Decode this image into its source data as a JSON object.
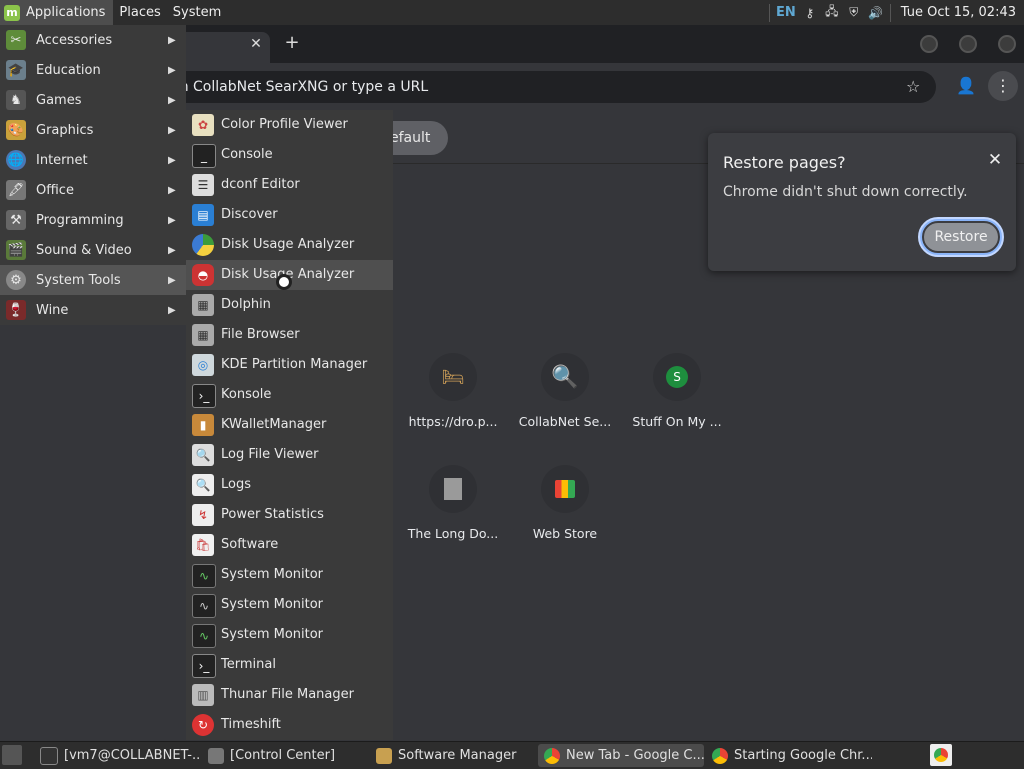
{
  "top_panel": {
    "applications_label": "Applications",
    "places_label": "Places",
    "system_label": "System",
    "lang": "EN",
    "clock": "Tue Oct 15, 02:43",
    "tray_icons": [
      "key-icon",
      "network-icon",
      "shield-icon",
      "volume-icon"
    ]
  },
  "menu": {
    "categories": [
      {
        "label": "Accessories",
        "icon": "accessories-icon"
      },
      {
        "label": "Education",
        "icon": "education-icon"
      },
      {
        "label": "Games",
        "icon": "games-icon"
      },
      {
        "label": "Graphics",
        "icon": "graphics-icon"
      },
      {
        "label": "Internet",
        "icon": "internet-icon"
      },
      {
        "label": "Office",
        "icon": "office-icon"
      },
      {
        "label": "Programming",
        "icon": "programming-icon"
      },
      {
        "label": "Sound & Video",
        "icon": "sound-video-icon"
      },
      {
        "label": "System Tools",
        "icon": "system-tools-icon"
      },
      {
        "label": "Wine",
        "icon": "wine-icon"
      }
    ],
    "items": [
      {
        "label": "Color Profile Viewer",
        "icon": "color-profile-icon"
      },
      {
        "label": "Console",
        "icon": "console-icon"
      },
      {
        "label": "dconf Editor",
        "icon": "dconf-icon"
      },
      {
        "label": "Discover",
        "icon": "discover-icon"
      },
      {
        "label": "Disk Usage Analyzer",
        "icon": "disk-usage-icon"
      },
      {
        "label": "Disk Usage Analyzer",
        "icon": "disk-usage-icon"
      },
      {
        "label": "Dolphin",
        "icon": "dolphin-icon"
      },
      {
        "label": "File Browser",
        "icon": "file-browser-icon"
      },
      {
        "label": "KDE Partition Manager",
        "icon": "partition-manager-icon"
      },
      {
        "label": "Konsole",
        "icon": "konsole-icon"
      },
      {
        "label": "KWalletManager",
        "icon": "kwallet-icon"
      },
      {
        "label": "Log File Viewer",
        "icon": "log-viewer-icon"
      },
      {
        "label": "Logs",
        "icon": "logs-icon"
      },
      {
        "label": "Power Statistics",
        "icon": "power-statistics-icon"
      },
      {
        "label": "Software",
        "icon": "software-icon"
      },
      {
        "label": "System Monitor",
        "icon": "system-monitor-icon"
      },
      {
        "label": "System Monitor",
        "icon": "system-monitor-icon"
      },
      {
        "label": "System Monitor",
        "icon": "system-monitor-icon"
      },
      {
        "label": "Terminal",
        "icon": "terminal-icon"
      },
      {
        "label": "Thunar File Manager",
        "icon": "thunar-icon"
      },
      {
        "label": "Timeshift",
        "icon": "timeshift-icon"
      }
    ]
  },
  "chrome": {
    "omnibox_text": "ch CollabNet SearXNG or type a URL",
    "infobar_button": "efault",
    "shortcuts": [
      {
        "label": "https://dro.p...",
        "icon": "bed-icon"
      },
      {
        "label": "CollabNet Se...",
        "icon": "search-icon"
      },
      {
        "label": "Stuff On My ...",
        "icon": "s-letter-icon",
        "letter": "S"
      },
      {
        "label": "The Long Do...",
        "icon": "site-thumbnail-icon"
      },
      {
        "label": "Web Store",
        "icon": "web-store-icon"
      }
    ],
    "restore": {
      "title": "Restore pages?",
      "message": "Chrome didn't shut down correctly.",
      "button": "Restore"
    }
  },
  "taskbar": {
    "tasks": [
      {
        "label": "[vm7@COLLABNET-..."
      },
      {
        "label": "[Control Center]"
      },
      {
        "label": "Software Manager"
      },
      {
        "label": "New Tab - Google C..."
      },
      {
        "label": "Starting Google Chr..."
      }
    ]
  }
}
